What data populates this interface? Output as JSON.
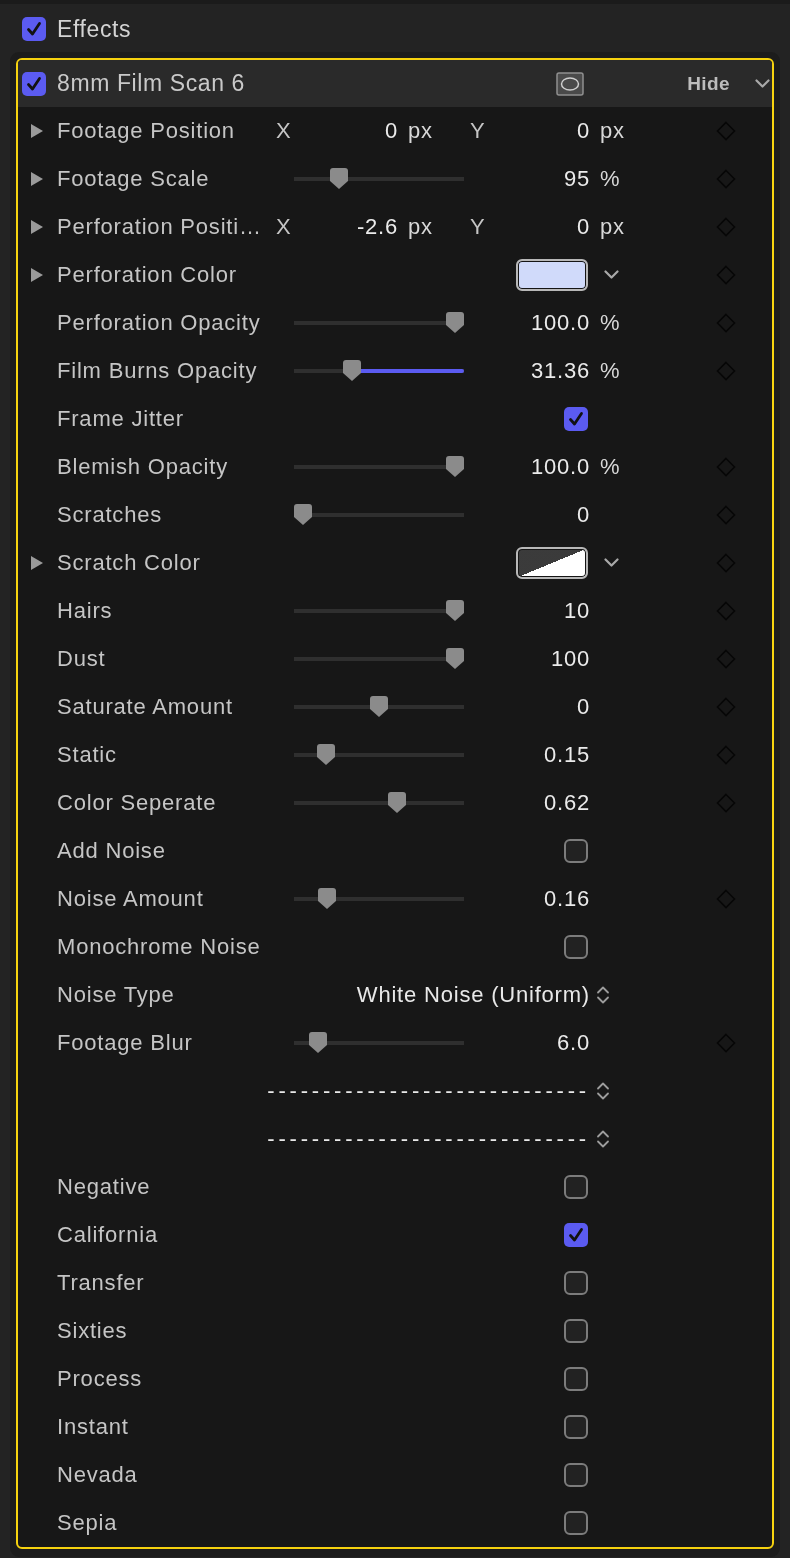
{
  "section": {
    "title": "Effects",
    "checked": true
  },
  "effect": {
    "title": "8mm Film Scan 6",
    "enabled": true,
    "selected": true,
    "hide_button": "Hide"
  },
  "params": [
    {
      "kind": "point",
      "label": "Footage Position",
      "expanded": false,
      "x_label": "X",
      "x_value": "0",
      "x_unit": "px",
      "y_label": "Y",
      "y_value": "0",
      "y_unit": "px",
      "keyframe": true
    },
    {
      "kind": "slider",
      "label": "Footage Scale",
      "expanded": false,
      "level": 0.24,
      "highlighted": false,
      "value": "95",
      "unit": "%",
      "keyframe": true
    },
    {
      "kind": "point",
      "label": "Perforation Positi…",
      "expanded": false,
      "x_label": "X",
      "x_value": "-2.6",
      "x_unit": "px",
      "y_label": "Y",
      "y_value": "0",
      "y_unit": "px",
      "keyframe": true
    },
    {
      "kind": "color",
      "label": "Perforation Color",
      "expanded": false,
      "color": "#d0dafa",
      "translucent": false,
      "keyframe": true
    },
    {
      "kind": "slider",
      "label": "Perforation Opacity",
      "level": 1,
      "highlighted": false,
      "value": "100.0",
      "unit": "%",
      "keyframe": true
    },
    {
      "kind": "slider",
      "label": "Film Burns Opacity",
      "level": 0.32,
      "highlighted": true,
      "value": "31.36",
      "unit": "%",
      "keyframe": true
    },
    {
      "kind": "checkbox",
      "label": "Frame Jitter",
      "checked": true,
      "keyframe": false
    },
    {
      "kind": "slider",
      "label": "Blemish Opacity",
      "level": 1,
      "highlighted": false,
      "value": "100.0",
      "unit": "%",
      "keyframe": true
    },
    {
      "kind": "slider",
      "label": "Scratches",
      "level": 0,
      "highlighted": false,
      "value": "0",
      "keyframe": true
    },
    {
      "kind": "color",
      "label": "Scratch Color",
      "expanded": false,
      "color": "#ffffff",
      "translucent": true,
      "keyframe": true
    },
    {
      "kind": "slider",
      "label": "Hairs",
      "level": 1,
      "highlighted": false,
      "value": "10",
      "keyframe": true
    },
    {
      "kind": "slider",
      "label": "Dust",
      "level": 1,
      "highlighted": false,
      "value": "100",
      "keyframe": true
    },
    {
      "kind": "slider",
      "label": "Saturate Amount",
      "level": 0.5,
      "highlighted": false,
      "value": "0",
      "keyframe": true
    },
    {
      "kind": "slider",
      "label": "Static",
      "level": 0.15,
      "highlighted": false,
      "value": "0.15",
      "keyframe": true
    },
    {
      "kind": "slider",
      "label": "Color Seperate",
      "level": 0.62,
      "highlighted": false,
      "value": "0.62",
      "keyframe": true
    },
    {
      "kind": "checkbox",
      "label": "Add Noise",
      "checked": false,
      "keyframe": false
    },
    {
      "kind": "slider",
      "label": "Noise Amount",
      "level": 0.16,
      "highlighted": false,
      "value": "0.16",
      "keyframe": true
    },
    {
      "kind": "checkbox",
      "label": "Monochrome Noise",
      "checked": false,
      "keyframe": false
    },
    {
      "kind": "popup",
      "label": "Noise Type",
      "value": "White Noise (Uniform)",
      "keyframe": false
    },
    {
      "kind": "slider",
      "label": "Footage Blur",
      "level": 0.1,
      "highlighted": false,
      "value": "6.0",
      "keyframe": true
    },
    {
      "kind": "popup",
      "value": "-----------------------------",
      "keyframe": false
    },
    {
      "kind": "popup",
      "value": "-----------------------------",
      "keyframe": false
    },
    {
      "kind": "checkbox",
      "label": "Negative",
      "checked": false,
      "keyframe": false
    },
    {
      "kind": "checkbox",
      "label": "California",
      "checked": true,
      "keyframe": false
    },
    {
      "kind": "checkbox",
      "label": "Transfer",
      "checked": false,
      "keyframe": false
    },
    {
      "kind": "checkbox",
      "label": "Sixties",
      "checked": false,
      "keyframe": false
    },
    {
      "kind": "checkbox",
      "label": "Process",
      "checked": false,
      "keyframe": false
    },
    {
      "kind": "checkbox",
      "label": "Instant",
      "checked": false,
      "keyframe": false
    },
    {
      "kind": "checkbox",
      "label": "Nevada",
      "checked": false,
      "keyframe": false
    },
    {
      "kind": "checkbox",
      "label": "Sepia",
      "checked": false,
      "keyframe": false
    }
  ]
}
